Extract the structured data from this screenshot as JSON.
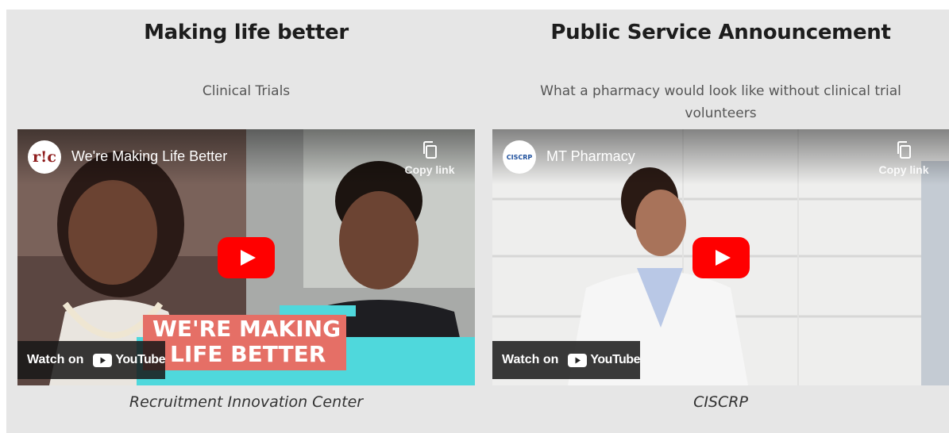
{
  "left": {
    "title": "Making life better",
    "subtitle": "Clinical Trials",
    "caption": "Recruitment Innovation Center",
    "video": {
      "channel_logo_text": "r!c",
      "title": "We're Making Life Better",
      "copy_link_label": "Copy link",
      "overlay_line1": "WE'RE MAKING",
      "overlay_line2": "LIFE BETTER",
      "watch_on_label": "Watch on",
      "youtube_label": "YouTube"
    }
  },
  "right": {
    "title": "Public Service Announcement",
    "subtitle": "What a pharmacy would look like without clinical trial volunteers",
    "caption": "CISCRP",
    "video": {
      "channel_logo_text": "CISCRP",
      "title": "MT Pharmacy",
      "copy_link_label": "Copy link",
      "watch_on_label": "Watch on",
      "youtube_label": "YouTube"
    }
  },
  "colors": {
    "panel_bg": "#e6e6e6",
    "youtube_red": "#ff0000",
    "overlay_salmon": "#e56f66",
    "overlay_teal": "#4fd8dc"
  }
}
